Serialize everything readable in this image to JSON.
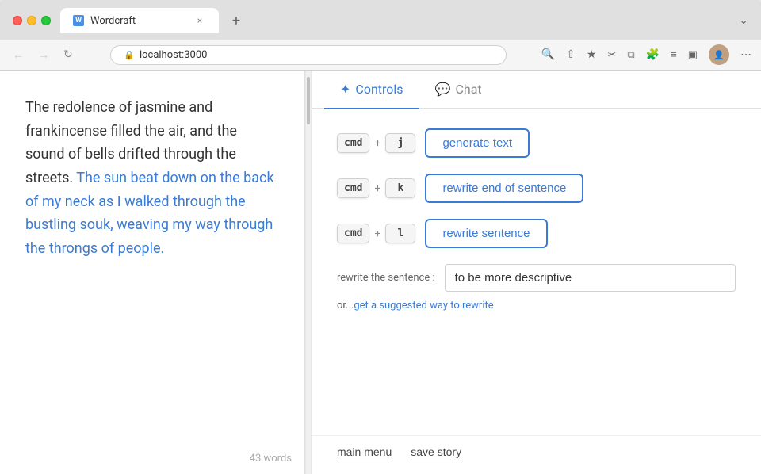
{
  "browser": {
    "tab_title": "Wordcraft",
    "url": "localhost:3000",
    "new_tab_label": "+",
    "close_label": "×",
    "more_label": "⌄"
  },
  "editor": {
    "text_normal": "The redolence of jasmine and frankincense filled the air, and the sound of bells drifted through the streets. ",
    "text_highlighted": "The sun beat down on the back of my neck as I walked through the bustling souk, weaving my way through the throngs of people.",
    "word_count": "43 words"
  },
  "controls": {
    "tabs": [
      {
        "id": "controls",
        "label": "Controls",
        "active": true
      },
      {
        "id": "chat",
        "label": "Chat",
        "active": false
      }
    ],
    "shortcuts": [
      {
        "modifier": "cmd",
        "plus": "+",
        "key": "j",
        "action": "generate text"
      },
      {
        "modifier": "cmd",
        "plus": "+",
        "key": "k",
        "action": "rewrite end of sentence"
      },
      {
        "modifier": "cmd",
        "plus": "+",
        "key": "l",
        "action": "rewrite sentence"
      }
    ],
    "rewrite": {
      "label": "rewrite the sentence :",
      "placeholder": "to be more descriptive",
      "input_value": "to be more descriptive",
      "suggest_prefix": "or...",
      "suggest_link_text": "get a suggested way to rewrite"
    },
    "bottom": {
      "main_menu": "main menu",
      "save_story": "save story"
    }
  }
}
